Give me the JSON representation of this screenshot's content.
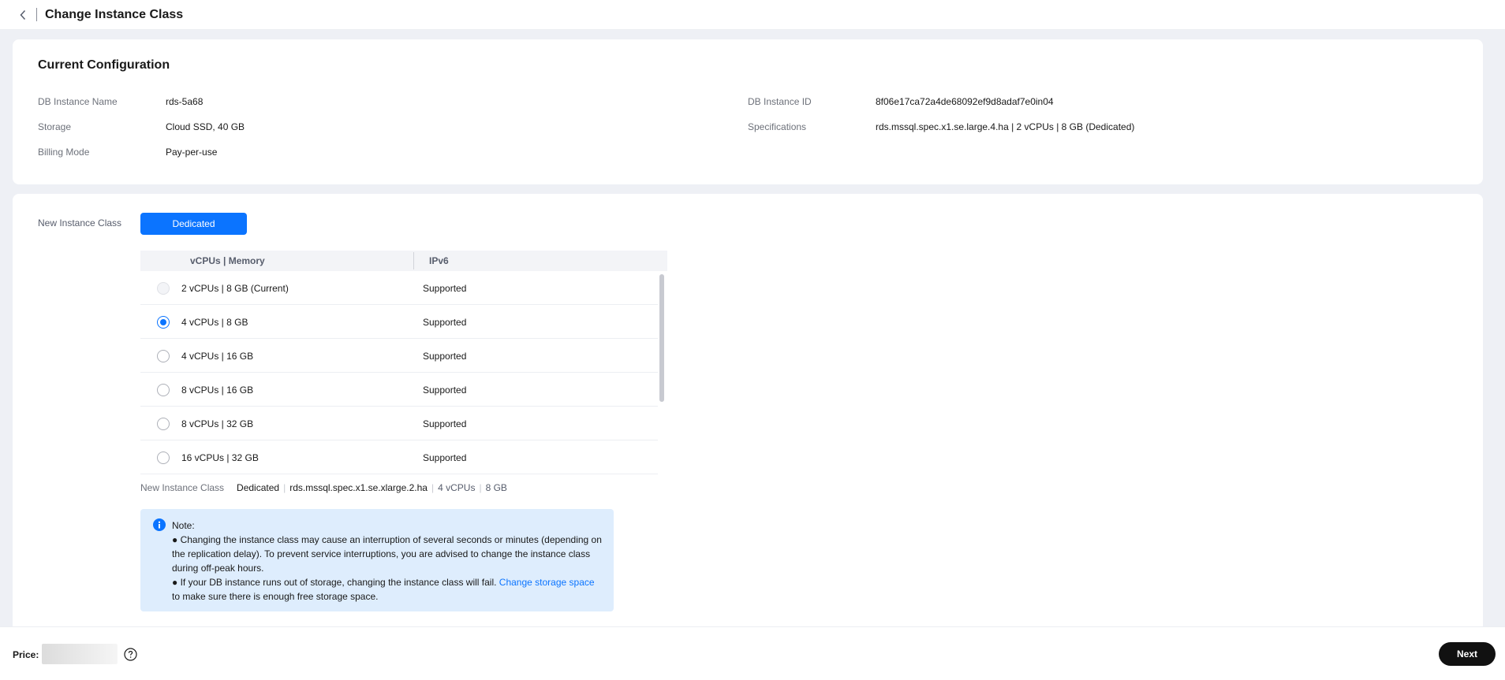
{
  "header": {
    "back_icon": "chevron-left-icon",
    "title": "Change Instance Class"
  },
  "current": {
    "title": "Current Configuration",
    "fields": {
      "name": {
        "label": "DB Instance Name",
        "value": "rds-5a68"
      },
      "storage": {
        "label": "Storage",
        "value": "Cloud SSD, 40 GB"
      },
      "billing": {
        "label": "Billing Mode",
        "value": "Pay-per-use"
      },
      "id": {
        "label": "DB Instance ID",
        "value": "8f06e17ca72a4de68092ef9d8adaf7e0in04"
      },
      "spec": {
        "label": "Specifications",
        "value": "rds.mssql.spec.x1.se.large.4.ha | 2 vCPUs | 8 GB (Dedicated)"
      }
    }
  },
  "new_class": {
    "label": "New Instance Class",
    "type_button": "Dedicated",
    "table": {
      "headers": [
        "vCPUs | Memory",
        "IPv6"
      ],
      "rows": [
        {
          "spec": "2 vCPUs | 8 GB (Current)",
          "ipv6": "Supported",
          "state": "disabled"
        },
        {
          "spec": "4 vCPUs | 8 GB",
          "ipv6": "Supported",
          "state": "checked"
        },
        {
          "spec": "4 vCPUs | 16 GB",
          "ipv6": "Supported",
          "state": "unchecked"
        },
        {
          "spec": "8 vCPUs | 16 GB",
          "ipv6": "Supported",
          "state": "unchecked"
        },
        {
          "spec": "8 vCPUs | 32 GB",
          "ipv6": "Supported",
          "state": "unchecked"
        },
        {
          "spec": "16 vCPUs | 32 GB",
          "ipv6": "Supported",
          "state": "unchecked"
        }
      ]
    },
    "summary": {
      "label": "New Instance Class",
      "type": "Dedicated",
      "spec_code": "rds.mssql.spec.x1.se.xlarge.2.ha",
      "vcpus": "4 vCPUs",
      "memory": "8 GB"
    },
    "note": {
      "title": "Note:",
      "line1": "● Changing the instance class may cause an interruption of several seconds or minutes (depending on the replication delay). To prevent service interruptions, you are advised to change the instance class during off-peak hours.",
      "line2_prefix": "● If your DB instance runs out of storage, changing the instance class will fail. ",
      "line2_link": "Change storage space",
      "line2_suffix": " to make sure there is enough free storage space."
    }
  },
  "footer": {
    "price_label": "Price:",
    "help_icon": "question-circle-icon",
    "next_label": "Next"
  },
  "colors": {
    "accent": "#0b74ff",
    "note_bg": "#deedfd",
    "next_bg": "#111111"
  }
}
